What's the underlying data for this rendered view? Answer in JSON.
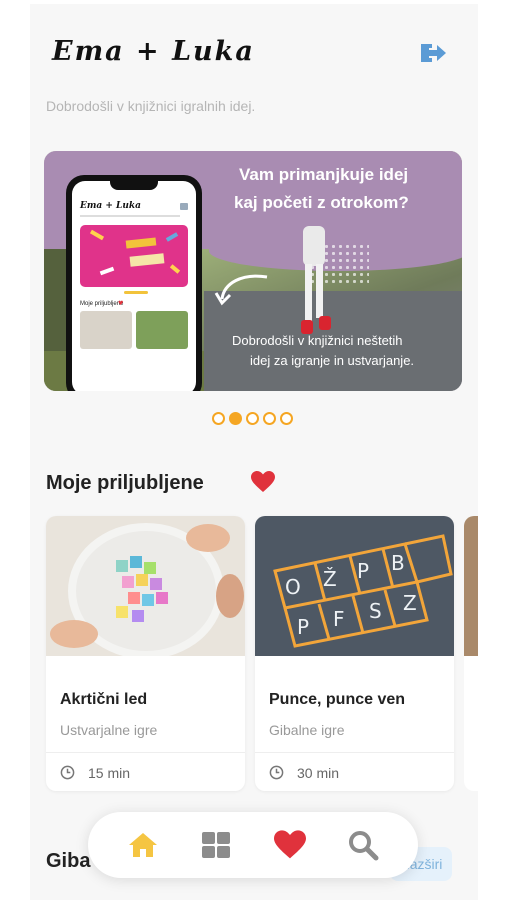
{
  "header": {
    "app_title": "Ema + Luka",
    "welcome": "Dobrodošli v knjižnici igralnih idej."
  },
  "banner": {
    "headline_line1": "Vam primanjkuje idej",
    "headline_line2": "kaj početi z otrokom?",
    "sub_line1": "Dobrodošli v knjižnici neštetih",
    "sub_line2": "idej za igranje in ustvarjanje.",
    "mock_app_title": "Ema + Luka",
    "mock_favorites_label": "Moje priljubljene",
    "active_index": 1,
    "total": 5
  },
  "favorites": {
    "title": "Moje priljubljene",
    "cards": [
      {
        "name": "Akrtični led",
        "category": "Ustvarjalne igre",
        "duration": "15 min"
      },
      {
        "name": "Punce, punce ven",
        "category": "Gibalne igre",
        "duration": "30 min"
      }
    ]
  },
  "bottom_section": {
    "title": "Giba",
    "expand_label": "Razširi"
  },
  "colors": {
    "accent_orange": "#f5a623",
    "heart_red": "#e0323c",
    "logout_blue": "#5b9bd5",
    "home_yellow": "#f5c542",
    "nav_gray": "#8c8c8c"
  },
  "icons": [
    "logout-icon",
    "heart-icon",
    "clock-icon",
    "home-icon",
    "grid-icon",
    "search-icon"
  ]
}
